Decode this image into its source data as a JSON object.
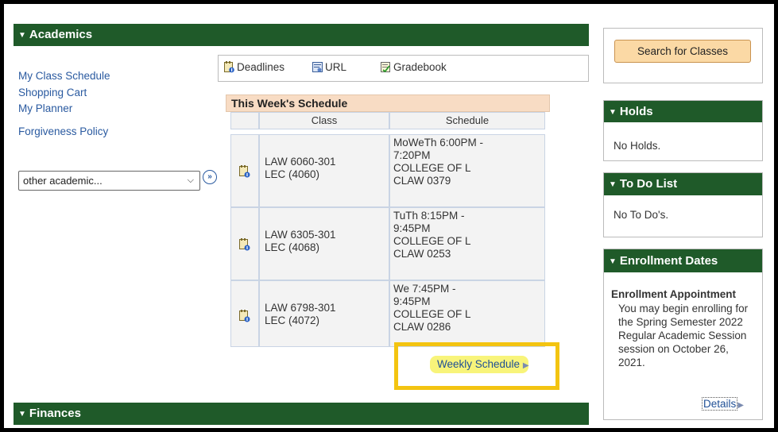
{
  "academics": {
    "header": "Academics",
    "links": [
      "My Class Schedule",
      "Shopping Cart",
      "My Planner",
      "Forgiveness Policy"
    ],
    "select_value": "other academic...",
    "toolbar": {
      "deadlines": "Deadlines",
      "url": "URL",
      "gradebook": "Gradebook"
    },
    "schedule": {
      "caption": "This Week's Schedule",
      "col_class": "Class",
      "col_schedule": "Schedule",
      "rows": [
        {
          "class_line1": "LAW 6060-301",
          "class_line2": "LEC (4060)",
          "schedule": "MoWeTh 6:00PM -\n7:20PM\nCOLLEGE OF L\nCLAW 0379"
        },
        {
          "class_line1": "LAW 6305-301",
          "class_line2": "LEC (4068)",
          "schedule": "TuTh 8:15PM -\n9:45PM\nCOLLEGE OF L\nCLAW 0253"
        },
        {
          "class_line1": "LAW 6798-301",
          "class_line2": "LEC (4072)",
          "schedule": "We 7:45PM -\n9:45PM\nCOLLEGE OF L\nCLAW 0286"
        }
      ],
      "weekly_link": "Weekly Schedule"
    }
  },
  "finances": {
    "header": "Finances"
  },
  "right": {
    "search_button": "Search for Classes",
    "holds": {
      "header": "Holds",
      "text": "No Holds."
    },
    "todo": {
      "header": "To Do List",
      "text": "No To Do's."
    },
    "enrollment": {
      "header": "Enrollment Dates",
      "title": "Enrollment Appointment",
      "lines": [
        "You may begin enrolling for",
        "the Spring Semester 2022",
        "Regular Academic Session",
        "session on October 26,",
        "2021."
      ],
      "details": "Details"
    }
  },
  "colors": {
    "header_green": "#1f5a29",
    "highlight_box": "#f3c411",
    "button_bg": "#fbd9a5",
    "link_blue": "#2a5aa0"
  }
}
